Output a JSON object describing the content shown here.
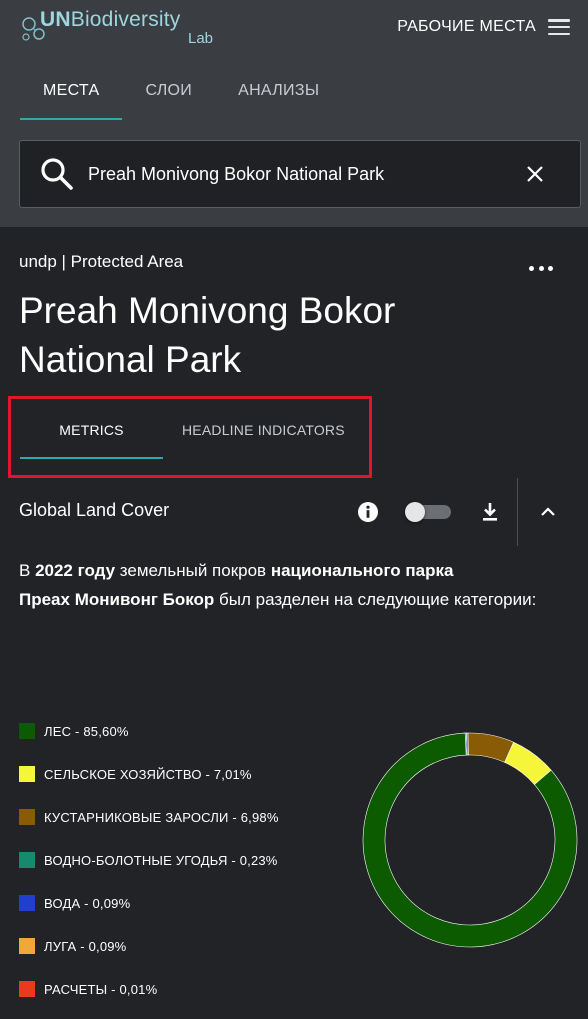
{
  "header": {
    "logo": {
      "prefix": "UN",
      "name": "Biodiversity",
      "suffix": "Lab"
    },
    "workspaces_label": "РАБОЧИЕ МЕСТА",
    "tabs": [
      {
        "label": "МЕСТА",
        "active": true
      },
      {
        "label": "СЛОИ",
        "active": false
      },
      {
        "label": "АНАЛИЗЫ",
        "active": false
      }
    ]
  },
  "search": {
    "value": "Preah Monivong Bokor National Park",
    "placeholder": ""
  },
  "place": {
    "source": "undp | Protected Area",
    "title": "Preah Monivong Bokor National Park"
  },
  "subtabs": [
    {
      "label": "METRICS",
      "active": true
    },
    {
      "label": "HEADLINE INDICATORS",
      "active": false
    }
  ],
  "section": {
    "title": "Global Land Cover",
    "layer_toggle_on": false
  },
  "description": {
    "p1": "В ",
    "year": "2022 году",
    "p2": " земельный покров ",
    "park_a": "национального парка",
    "park_b": "Преах Монивонг Бокор",
    "p3": " был разделен на следующие категории:"
  },
  "colors": {
    "accent": "#2fa8b4",
    "highlight_box": "#e0162b",
    "header_bg": "#3a3d42",
    "content_bg": "#212327"
  },
  "chart_data": {
    "type": "pie",
    "donut": true,
    "categories": [
      "ЛЕС",
      "СЕЛЬСКОЕ ХОЗЯЙСТВО",
      "КУСТАРНИКОВЫЕ ЗАРОСЛИ",
      "ВОДНО-БОЛОТНЫЕ УГОДЬЯ",
      "ВОДА",
      "ЛУГА",
      "РАСЧЕТЫ"
    ],
    "values": [
      85.6,
      7.01,
      6.98,
      0.23,
      0.09,
      0.09,
      0.01
    ],
    "value_labels": [
      "85,60%",
      "7,01%",
      "6,98%",
      "0,23%",
      "0,09%",
      "0,09%",
      "0,01%"
    ],
    "colors": [
      "#0c5b00",
      "#f5f53a",
      "#8a5b07",
      "#168a6f",
      "#1f3fd1",
      "#f1a73a",
      "#e93a1c"
    ],
    "legend_position": "left",
    "legend_labels": [
      "ЛЕС - 85,60%",
      "СЕЛЬСКОЕ ХОЗЯЙСТВО - 7,01%",
      "КУСТАРНИКОВЫЕ ЗАРОСЛИ - 6,98%",
      "ВОДНО-БОЛОТНЫЕ УГОДЬЯ - 0,23%",
      "ВОДА - 0,09%",
      "ЛУГА - 0,09%",
      "РАСЧЕТЫ - 0,01%"
    ]
  }
}
